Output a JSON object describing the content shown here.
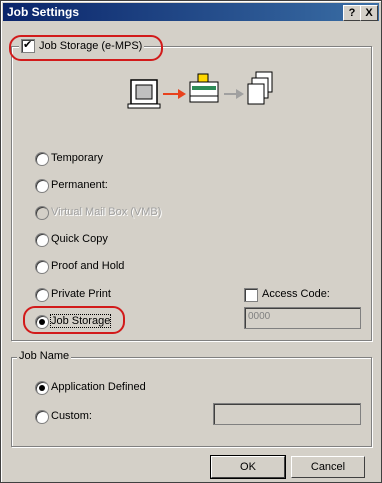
{
  "window": {
    "title": "Job Settings",
    "help_label": "?",
    "close_label": "X"
  },
  "storage_group": {
    "checkbox_label": "Job Storage (e-MPS)",
    "checked": true
  },
  "options": [
    {
      "label": "Temporary",
      "checked": false,
      "disabled": false
    },
    {
      "label": "Permanent:",
      "checked": false,
      "disabled": false
    },
    {
      "label": "Virtual Mail Box (VMB)",
      "checked": false,
      "disabled": true
    },
    {
      "label": "Quick Copy",
      "checked": false,
      "disabled": false
    },
    {
      "label": "Proof and Hold",
      "checked": false,
      "disabled": false
    },
    {
      "label": "Private Print",
      "checked": false,
      "disabled": false
    },
    {
      "label": "Job Storage",
      "checked": true,
      "disabled": false
    }
  ],
  "access_code": {
    "label": "Access Code:",
    "value": "0000",
    "checked": false
  },
  "job_name": {
    "legend": "Job Name",
    "app_label": "Application Defined",
    "custom_label": "Custom:",
    "custom_value": ""
  },
  "buttons": {
    "ok": "OK",
    "cancel": "Cancel"
  },
  "colors": {
    "title_bar": "#0a246a",
    "highlight": "#d21a1a",
    "arrow": "#e8411c"
  }
}
